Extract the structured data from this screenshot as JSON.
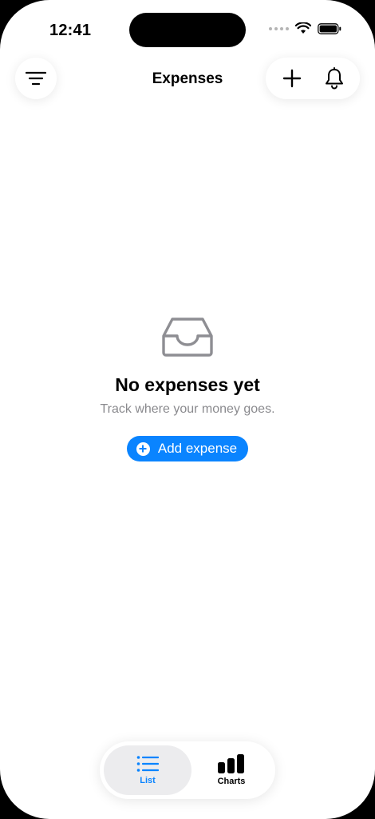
{
  "status_bar": {
    "time": "12:41"
  },
  "nav": {
    "title": "Expenses",
    "left_icon": "filter-icon",
    "right_icons": [
      "plus-icon",
      "bell-icon"
    ]
  },
  "empty_state": {
    "icon": "tray-icon",
    "title": "No expenses yet",
    "subtitle": "Track where your money goes.",
    "button_label": "Add expense"
  },
  "tab_bar": {
    "tabs": [
      {
        "label": "List",
        "icon": "list-icon",
        "selected": true
      },
      {
        "label": "Charts",
        "icon": "bar-chart-icon",
        "selected": false
      }
    ]
  },
  "colors": {
    "accent": "#0a84ff",
    "secondary_text": "#8a8a8e",
    "icon_gray": "#8e8e93"
  }
}
